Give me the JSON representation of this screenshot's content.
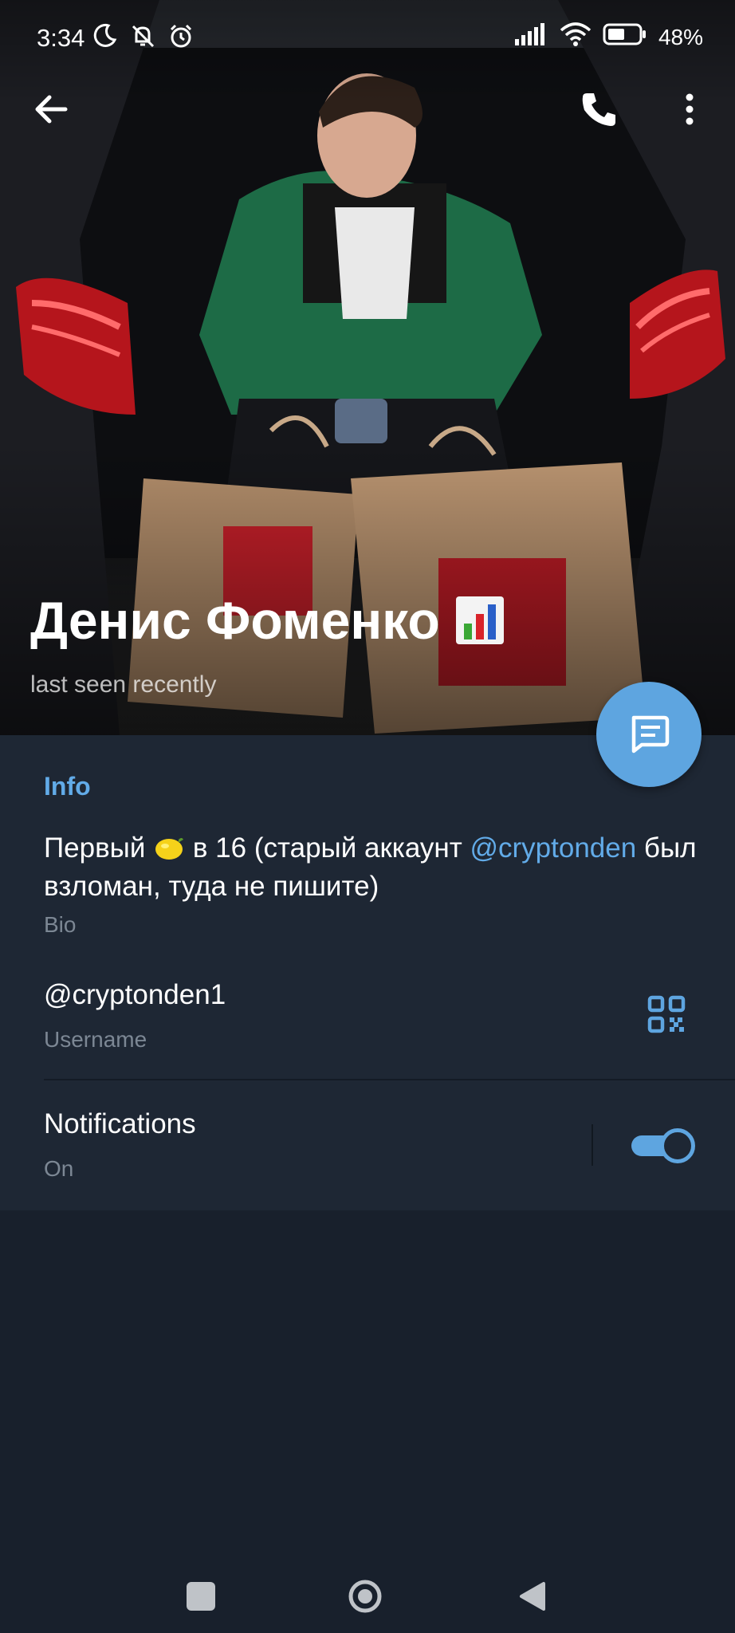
{
  "status_bar": {
    "time": "3:34",
    "battery": "48%",
    "icons": [
      "moon-icon",
      "muted-bell-icon",
      "alarm-icon",
      "signal-icon",
      "wifi-icon",
      "battery-icon"
    ]
  },
  "header": {
    "name": "Денис Фоменко",
    "name_emoji": "bar-chart-emoji",
    "last_seen": "last seen recently",
    "actions": [
      "back-arrow-icon",
      "phone-icon",
      "more-vertical-icon"
    ]
  },
  "info": {
    "section_title": "Info",
    "bio_part1": "Первый ",
    "bio_part2": " в 16 (старый аккаунт ",
    "bio_link": "@cryptonden",
    "bio_part3": " был взломан, туда не пишите)",
    "bio_caption": "Bio",
    "username": "@cryptonden1",
    "username_caption": "Username",
    "notifications_label": "Notifications",
    "notifications_value": "On",
    "notifications_enabled": true
  },
  "colors": {
    "accent": "#62abe8",
    "panel": "#1e2734",
    "background": "#18202c"
  },
  "nav": [
    "recents-square-icon",
    "home-circle-icon",
    "back-triangle-icon"
  ]
}
